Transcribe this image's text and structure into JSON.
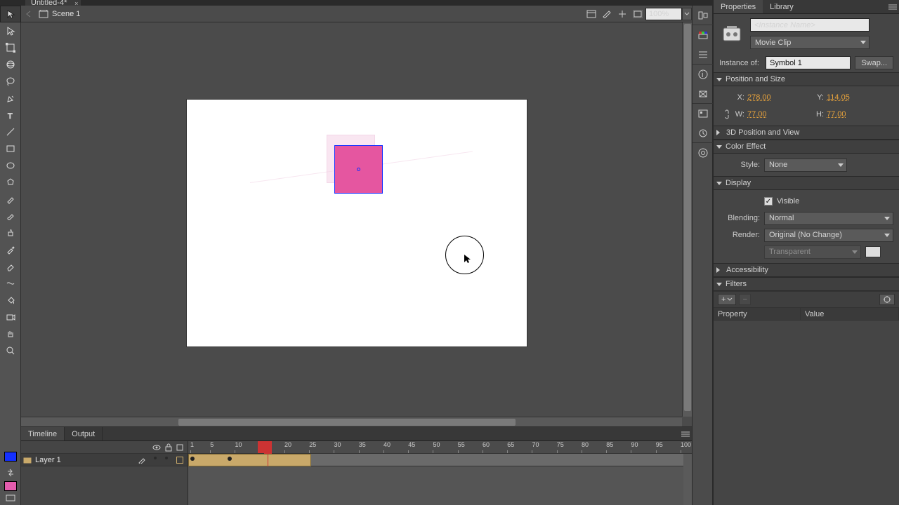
{
  "document": {
    "title": "Untitled-4*"
  },
  "editbar": {
    "scene": "Scene 1",
    "zoom": "100%"
  },
  "tools": [
    "selection",
    "subselection",
    "free-transform",
    "3d-rotation",
    "lasso",
    "pen",
    "text",
    "line",
    "rectangle",
    "oval",
    "polystar",
    "pencil",
    "brush",
    "ink-bottle",
    "eyedropper",
    "eraser",
    "width",
    "paint-bucket",
    "camera",
    "hand",
    "zoom"
  ],
  "timeline": {
    "tabs": [
      "Timeline",
      "Output"
    ],
    "activeTab": 0,
    "ruler": [
      "1",
      "5",
      "10",
      "15",
      "20",
      "25",
      "30",
      "35",
      "40",
      "45",
      "50",
      "55",
      "60",
      "65",
      "70",
      "75",
      "80",
      "85",
      "90",
      "95",
      "100"
    ],
    "layers": [
      {
        "name": "Layer 1"
      }
    ],
    "currentFrame": 15,
    "spanEnd": 25,
    "headIcons": [
      "eye",
      "lock",
      "outline"
    ]
  },
  "propsPanel": {
    "tabs": [
      "Properties",
      "Library"
    ],
    "activeTab": 0,
    "instanceNamePlaceholder": "<Instance Name>",
    "typeLabel": "Movie Clip",
    "instanceOf": {
      "label": "Instance of:",
      "value": "Symbol 1",
      "swap": "Swap..."
    },
    "sections": {
      "posSize": {
        "title": "Position and Size",
        "X": "278.00",
        "Y": "114.05",
        "W": "77.00",
        "H": "77.00",
        "xl": "X:",
        "yl": "Y:",
        "wl": "W:",
        "hl": "H:"
      },
      "threeD": {
        "title": "3D Position and View"
      },
      "colorEffect": {
        "title": "Color Effect",
        "styleLabel": "Style:",
        "style": "None"
      },
      "display": {
        "title": "Display",
        "visible": "Visible",
        "blendLabel": "Blending:",
        "blend": "Normal",
        "renderLabel": "Render:",
        "render": "Original (No Change)",
        "transparent": "Transparent"
      },
      "accessibility": {
        "title": "Accessibility"
      },
      "filters": {
        "title": "Filters",
        "add": "+",
        "colProperty": "Property",
        "colValue": "Value"
      }
    }
  },
  "dockIcons": [
    "align-panel",
    "color-panel",
    "swatches-panel",
    "info-panel",
    "transform-panel",
    "components-panel",
    "history-panel",
    "cc-libraries"
  ]
}
